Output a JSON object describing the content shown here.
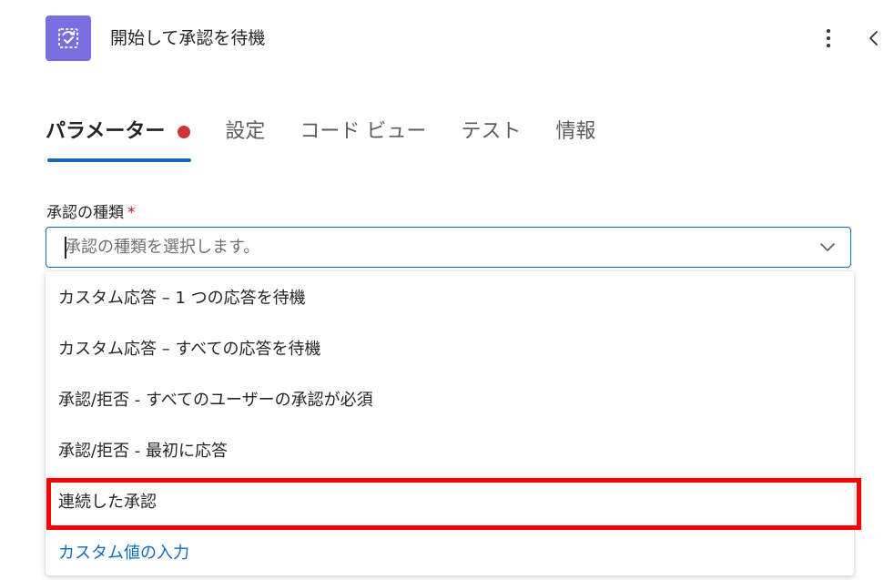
{
  "header": {
    "title": "開始して承認を待機",
    "icon": "approval-icon",
    "more_icon": "more-vertical-icon",
    "collapse_icon": "chevron-left-icon",
    "accent_color": "#7a6fe0"
  },
  "tabs": [
    {
      "label": "パラメーター",
      "active": true,
      "has_error_dot": true
    },
    {
      "label": "設定",
      "active": false
    },
    {
      "label": "コード ビュー",
      "active": false
    },
    {
      "label": "テスト",
      "active": false
    },
    {
      "label": "情報",
      "active": false
    }
  ],
  "field": {
    "label": "承認の種類",
    "required_mark": "*",
    "placeholder": "承認の種類を選択します。",
    "value": ""
  },
  "dropdown": {
    "options": [
      {
        "label": "カスタム応答 – 1 つの応答を待機"
      },
      {
        "label": "カスタム応答 – すべての応答を待機"
      },
      {
        "label": "承認/拒否 - すべてのユーザーの承認が必須"
      },
      {
        "label": "承認/拒否 - 最初に応答"
      },
      {
        "label": "連続した承認",
        "highlighted": true
      },
      {
        "label": "カスタム値の入力",
        "custom": true
      }
    ]
  },
  "colors": {
    "tab_underline": "#0f6cbd",
    "error_dot": "#d13438",
    "highlight_box": "#ff0000",
    "link": "#0f6cbd"
  }
}
